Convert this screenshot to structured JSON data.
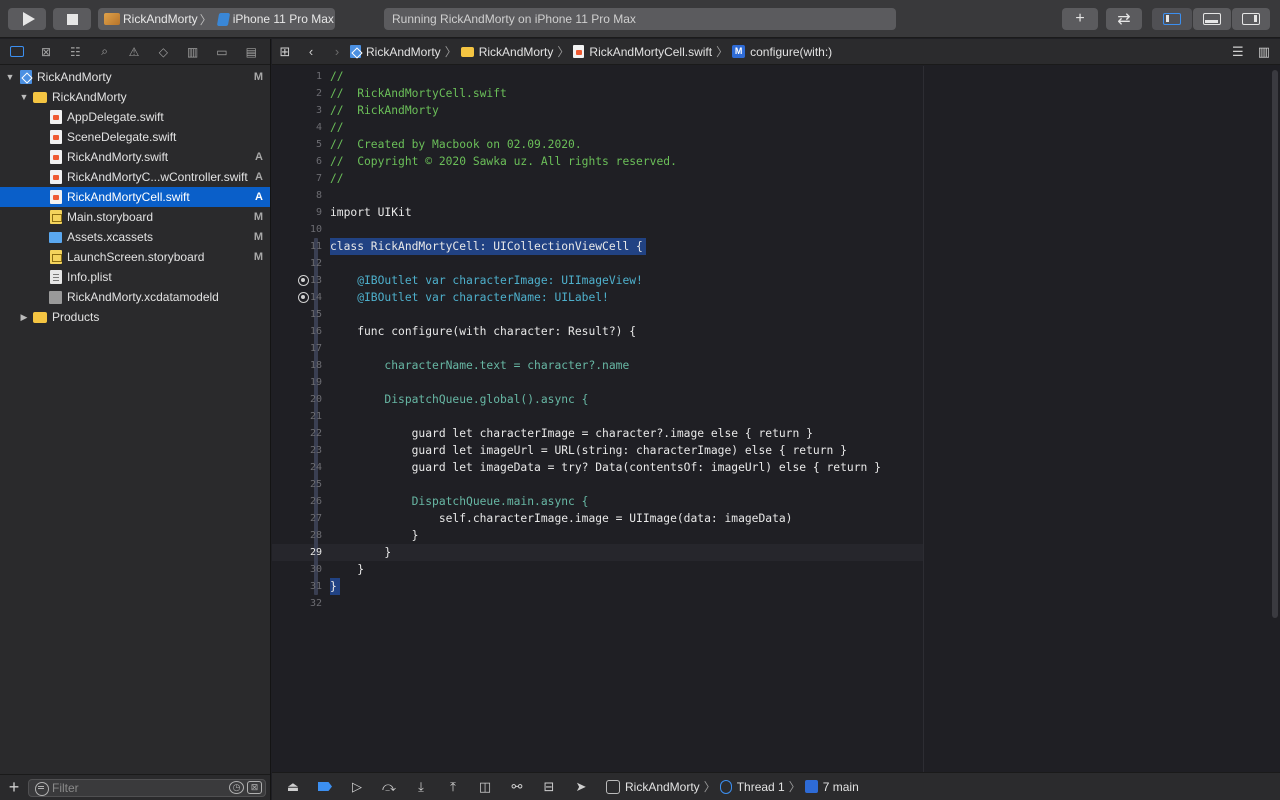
{
  "toolbar": {
    "scheme_app": "RickAndMorty",
    "scheme_device": "iPhone 11 Pro Max",
    "activity_status": "Running RickAndMorty on iPhone 11 Pro Max",
    "add_label": "+",
    "swap_label": "⇄"
  },
  "navigator": {
    "items": [
      {
        "label": "RickAndMorty",
        "icon": "project-icon",
        "status": "M"
      },
      {
        "label": "RickAndMorty",
        "icon": "folder-icon",
        "status": ""
      },
      {
        "label": "AppDelegate.swift",
        "icon": "swift-file-icon",
        "status": ""
      },
      {
        "label": "SceneDelegate.swift",
        "icon": "swift-file-icon",
        "status": ""
      },
      {
        "label": "RickAndMorty.swift",
        "icon": "swift-file-icon",
        "status": "A"
      },
      {
        "label": "RickAndMortyC...wController.swift",
        "icon": "swift-file-icon",
        "status": "A"
      },
      {
        "label": "RickAndMortyCell.swift",
        "icon": "swift-file-icon",
        "status": "A"
      },
      {
        "label": "Main.storyboard",
        "icon": "storyboard-file-icon",
        "status": "M"
      },
      {
        "label": "Assets.xcassets",
        "icon": "xcassets-folder-icon",
        "status": "M"
      },
      {
        "label": "LaunchScreen.storyboard",
        "icon": "storyboard-file-icon",
        "status": "M"
      },
      {
        "label": "Info.plist",
        "icon": "plist-file-icon",
        "status": ""
      },
      {
        "label": "RickAndMorty.xcdatamodeld",
        "icon": "xcdatamodeld-icon",
        "status": ""
      },
      {
        "label": "Products",
        "icon": "folder-icon",
        "status": ""
      }
    ],
    "filter_placeholder": "Filter"
  },
  "jumpbar": {
    "crumbs": [
      "RickAndMorty",
      "RickAndMorty",
      "RickAndMortyCell.swift",
      "configure(with:)"
    ],
    "method_badge": "M"
  },
  "editor": {
    "line_numbers": [
      "1",
      "2",
      "3",
      "4",
      "5",
      "6",
      "7",
      "8",
      "9",
      "10",
      "11",
      "12",
      "13",
      "14",
      "15",
      "16",
      "17",
      "18",
      "19",
      "20",
      "21",
      "22",
      "23",
      "24",
      "25",
      "26",
      "27",
      "28",
      "29",
      "30",
      "31",
      "32"
    ],
    "current_line": "29",
    "lines": [
      "//",
      "//  RickAndMortyCell.swift",
      "//  RickAndMorty",
      "//",
      "//  Created by Macbook on 02.09.2020.",
      "//  Copyright © 2020 Sawka uz. All rights reserved.",
      "//",
      "",
      "import UIKit",
      "",
      "class RickAndMortyCell: UICollectionViewCell {",
      "",
      "    @IBOutlet var characterImage: UIImageView!",
      "    @IBOutlet var characterName: UILabel!",
      "",
      "    func configure(with character: Result?) {",
      "",
      "        characterName.text = character?.name",
      "",
      "        DispatchQueue.global().async {",
      "",
      "            guard let characterImage = character?.image else { return }",
      "            guard let imageUrl = URL(string: characterImage) else { return }",
      "            guard let imageData = try? Data(contentsOf: imageUrl) else { return }",
      "",
      "            DispatchQueue.main.async {",
      "                self.characterImage.image = UIImage(data: imageData)",
      "            }",
      "        }",
      "    }",
      "}",
      ""
    ]
  },
  "debugbar": {
    "process": "RickAndMorty",
    "thread": "Thread 1",
    "frame": "7 main"
  },
  "colors": {
    "accent": "#0a5fc9",
    "comment": "#6bbf59",
    "keyword": "#fc5fa3",
    "selection": "#214283"
  }
}
